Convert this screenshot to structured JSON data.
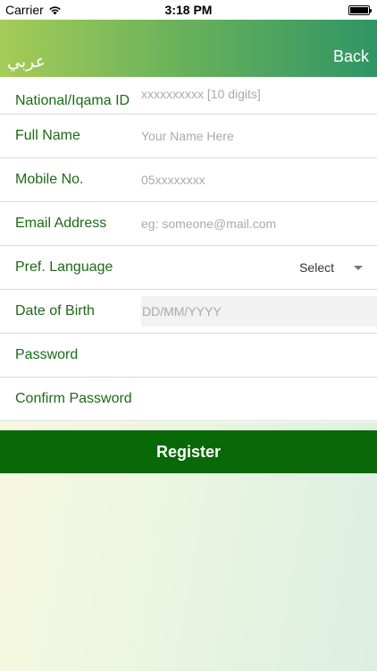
{
  "status_bar": {
    "carrier": "Carrier",
    "time": "3:18 PM"
  },
  "header": {
    "language_toggle": "عربي",
    "back_label": "Back",
    "gradient_start": "#a5cc58",
    "gradient_end": "#2f9565"
  },
  "form": {
    "national_id": {
      "label": "National/Iqama ID",
      "placeholder": "xxxxxxxxxx [10 digits]",
      "value": ""
    },
    "full_name": {
      "label": "Full Name",
      "placeholder": "Your Name Here",
      "value": ""
    },
    "mobile": {
      "label": "Mobile No.",
      "placeholder": "05xxxxxxxx",
      "value": ""
    },
    "email": {
      "label": "Email Address",
      "placeholder": "eg: someone@mail.com",
      "value": ""
    },
    "pref_language": {
      "label": "Pref. Language",
      "selected": "Select"
    },
    "dob": {
      "label": "Date of Birth",
      "placeholder": "DD/MM/YYYY"
    },
    "password": {
      "label": "Password",
      "value": ""
    },
    "confirm_password": {
      "label": "Confirm Password",
      "value": ""
    }
  },
  "register_button": {
    "label": "Register",
    "color": "#096808"
  },
  "colors": {
    "label_green": "#1a6b14"
  }
}
